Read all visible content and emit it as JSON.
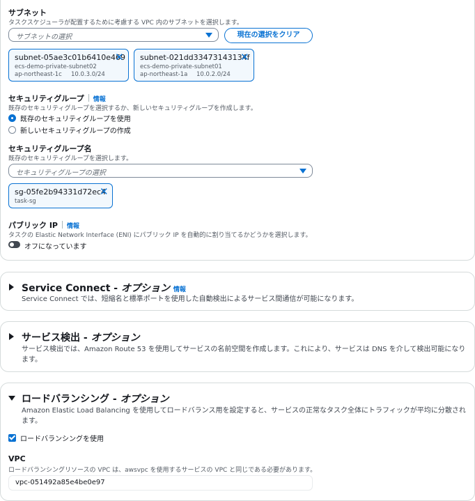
{
  "subnets": {
    "label": "サブネット",
    "description": "タスクスケジューラが配置するために考慮する VPC 内のサブネットを選択します。",
    "placeholder": "サブネットの選択",
    "clear_button": "現在の選択をクリア",
    "tokens": [
      {
        "id": "subnet-05ae3c01b6410e469",
        "name": "ecs-demo-private-subnet02",
        "az": "ap-northeast-1c",
        "cidr": "10.0.3.0/24"
      },
      {
        "id": "subnet-021dd33473143134f",
        "name": "ecs-demo-private-subnet01",
        "az": "ap-northeast-1a",
        "cidr": "10.0.2.0/24"
      }
    ]
  },
  "security_group": {
    "label": "セキュリティグループ",
    "info": "情報",
    "description": "既存のセキュリティグループを選択するか、新しいセキュリティグループを作成します。",
    "options": [
      "既存のセキュリティグループを使用",
      "新しいセキュリティグループの作成"
    ],
    "selected": 0
  },
  "security_group_name": {
    "label": "セキュリティグループ名",
    "description": "既存のセキュリティグループを選択します。",
    "placeholder": "セキュリティグループの選択",
    "token": {
      "id": "sg-05fe2b94331d72ec4",
      "name": "task-sg"
    }
  },
  "public_ip": {
    "label": "パブリック IP",
    "info": "情報",
    "description": "タスクの Elastic Network Interface (ENI) にパブリック IP を自動的に割り当てるかどうかを選択します。",
    "toggle_label": "オフになっています",
    "enabled": false
  },
  "service_connect": {
    "title": "Service Connect - ",
    "optional": "オプション",
    "info": "情報",
    "description": "Service Connect では、短縮名と標準ポートを使用した自動検出によるサービス間通信が可能になります。",
    "expanded": false
  },
  "service_discovery": {
    "title": "サービス検出 - ",
    "optional": "オプション",
    "description": "サービス検出では、Amazon Route 53 を使用してサービスの名前空間を作成します。これにより、サービスは DNS を介して検出可能になります。",
    "expanded": false
  },
  "load_balancing": {
    "title": "ロードバランシング - ",
    "optional": "オプション",
    "description": "Amazon Elastic Load Balancing を使用してロードバランス用を設定すると、サービスの正常なタスク全体にトラフィックが平均に分散されます。",
    "expanded": true,
    "use_label": "ロードバランシングを使用",
    "use_checked": true,
    "vpc_label": "VPC",
    "vpc_description": "ロードバランシングリソースの VPC は、awsvpc を使用するサービスの VPC と同じである必要があります。",
    "vpc_value": "vpc-051492a85e4be0e97"
  },
  "colors": {
    "accent": "#0972d3",
    "text": "#16191f",
    "muted": "#545b64",
    "border": "#d5dbdb"
  }
}
